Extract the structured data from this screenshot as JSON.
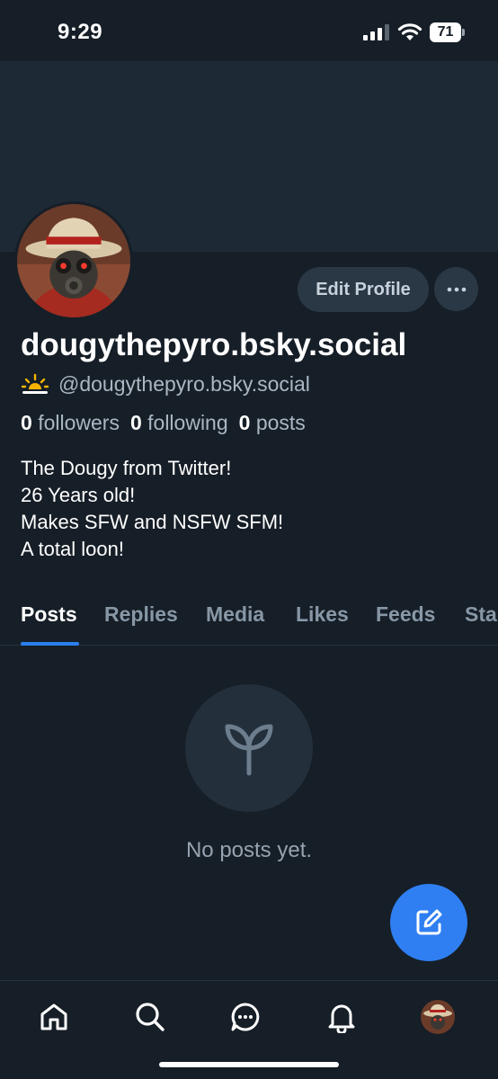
{
  "status_bar": {
    "time": "9:29",
    "battery": "71"
  },
  "profile": {
    "display_name": "dougythepyro.bsky.social",
    "handle": "@dougythepyro.bsky.social",
    "handle_icon": "sunrise-icon",
    "edit_button": "Edit Profile",
    "more_icon": "more-horizontal-icon",
    "stats": {
      "followers_count": "0",
      "followers_label": "followers",
      "following_count": "0",
      "following_label": "following",
      "posts_count": "0",
      "posts_label": "posts"
    },
    "bio": [
      "The Dougy from Twitter!",
      "26 Years old!",
      "Makes SFW and NSFW SFM!",
      "A total loon!"
    ]
  },
  "tabs": [
    "Posts",
    "Replies",
    "Media",
    "Likes",
    "Feeds",
    "Sta"
  ],
  "active_tab": "Posts",
  "empty_state": {
    "icon": "sprout-icon",
    "text": "No posts yet."
  },
  "fab": {
    "icon": "compose-icon"
  },
  "bottom_nav": [
    "home-icon",
    "search-icon",
    "chat-icon",
    "bell-icon",
    "profile-avatar"
  ],
  "colors": {
    "background": "#161e27",
    "banner": "#1d2a36",
    "accent": "#2f7ff2",
    "muted_text": "#aab7c4",
    "button_bg": "#2a3846"
  }
}
